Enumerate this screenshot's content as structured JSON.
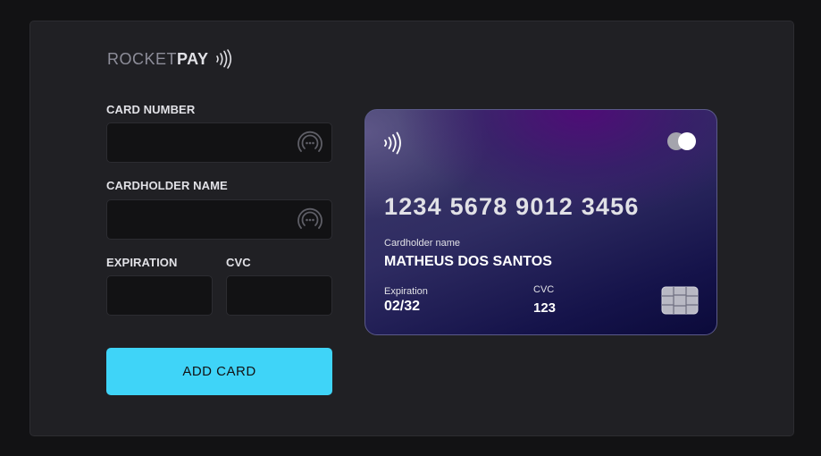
{
  "brand": {
    "name_light": "ROCKET",
    "name_bold": "PAY",
    "logo_icon": "contactless-icon"
  },
  "form": {
    "card_number": {
      "label": "CARD NUMBER",
      "value": "",
      "placeholder": "",
      "icon": "fingerprint-dots-icon"
    },
    "cardholder_name": {
      "label": "CARDHOLDER NAME",
      "value": "",
      "placeholder": "",
      "icon": "fingerprint-dots-icon"
    },
    "expiration": {
      "label": "EXPIRATION",
      "value": "",
      "placeholder": ""
    },
    "cvc": {
      "label": "CVC",
      "value": "",
      "placeholder": ""
    },
    "submit_label": "ADD CARD"
  },
  "card_preview": {
    "number": "1234 5678 9012 3456",
    "holder_label": "Cardholder name",
    "holder_value": "MATHEUS DOS SANTOS",
    "expiration_label": "Expiration",
    "expiration_value": "02/32",
    "cvc_label": "CVC",
    "cvc_value": "123",
    "nfc_icon": "contactless-icon",
    "brand_icon": "mastercard-icon",
    "chip_icon": "chip-icon"
  },
  "colors": {
    "background": "#121214",
    "panel": "#202024",
    "input_bg": "#121214",
    "accent": "#3fd4f8",
    "text": "#e1e1e6",
    "card_purple": "#4f0a78",
    "card_navy": "#0b0a3a"
  }
}
